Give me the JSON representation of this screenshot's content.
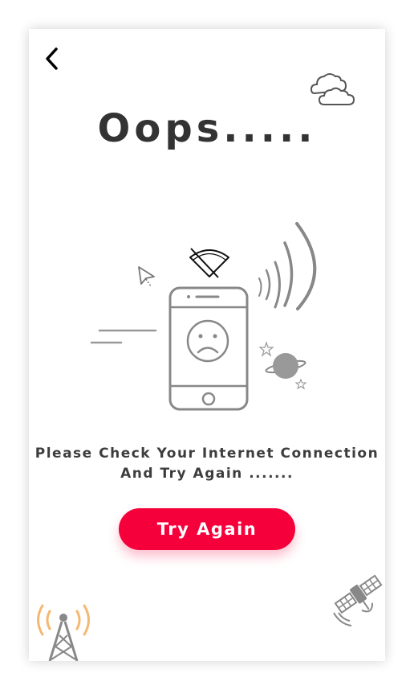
{
  "header": {
    "title": "Oops....."
  },
  "message": {
    "line1": "Please Check Your Internet Connection",
    "line2": "And Try Again ......."
  },
  "actions": {
    "try_again_label": "Try Again"
  },
  "colors": {
    "accent": "#f5003a",
    "text": "#333333",
    "illustration": "#8a8a8a",
    "tower_signal": "#f5b872"
  },
  "icons": [
    "back-arrow-icon",
    "cloud-icon",
    "wifi-off-icon",
    "cursor-icon",
    "sad-phone-icon",
    "planet-icon",
    "star-icon",
    "signal-tower-icon",
    "satellite-icon"
  ]
}
